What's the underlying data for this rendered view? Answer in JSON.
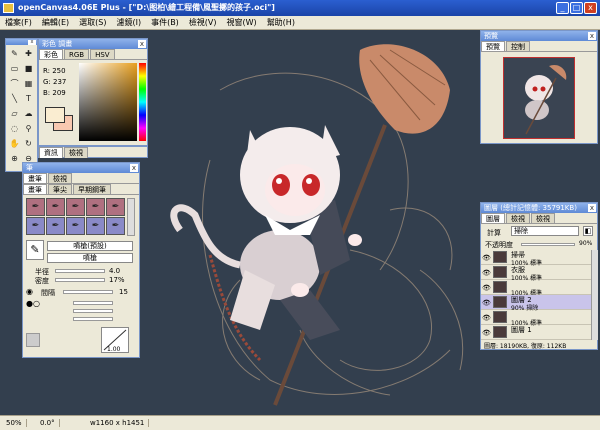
{
  "window": {
    "title": "openCanvas4.06E Plus - [\"D:\\图柏\\繪工程備\\風聖擲的孩子.oci\"]",
    "min": "_",
    "max": "□",
    "close": "x"
  },
  "menu": [
    "檔案(F)",
    "編輯(E)",
    "選取(S)",
    "濾鏡(I)",
    "事件(B)",
    "檢視(V)",
    "視窗(W)",
    "幫助(H)"
  ],
  "color_panel": {
    "title": "彩色 調畫",
    "tabs": [
      "彩色",
      "RGB",
      "HSV"
    ],
    "r": "R: 250",
    "g": "G: 237",
    "b": "B: 209",
    "fg": "#faedd1",
    "bg": "#f8c8b0"
  },
  "tool_icons": [
    "pen-icon",
    "move-icon",
    "rect-select-icon",
    "fill-icon",
    "lasso-icon",
    "gradient-icon",
    "line-icon",
    "text-icon",
    "eraser-icon",
    "smudge-icon",
    "blur-icon",
    "eyedropper-icon",
    "hand-icon",
    "rotate-icon",
    "zoom-in-icon",
    "zoom-out-icon"
  ],
  "tool_glyphs": [
    "✎",
    "✚",
    "▭",
    "■",
    "⌒",
    "▦",
    "╲",
    "T",
    "▱",
    "☁",
    "◌",
    "⚲",
    "✋",
    "↻",
    "⊕",
    "⊖"
  ],
  "brush_panel": {
    "title": "筆",
    "tabs": [
      "畫筆",
      "檢視"
    ],
    "subtabs": [
      "畫筆",
      "筆尖",
      "早期鋼筆"
    ],
    "preset_btn": "噴槍(預設)",
    "name_btn": "噴槍",
    "radius_label": "半徑",
    "radius_val": "4.0",
    "density_label": "密度",
    "density_val": "17%",
    "spacing_label": "間隔",
    "spacing_val": "15",
    "pressure_val": "1.00",
    "under_tabs": [
      "資訊",
      "檢視"
    ]
  },
  "preview_panel": {
    "title": "預覽",
    "tabs": [
      "預覽",
      "控制"
    ]
  },
  "layer_panel": {
    "title": "圖層 (總計記憶體: 35791KB)",
    "tabs": [
      "圖層",
      "檢視",
      "檢視"
    ],
    "blend_label": "計算",
    "blend_val": "掃除",
    "opacity_label": "不透明度",
    "opacity_val": "90%",
    "layers": [
      {
        "name": "掃帚",
        "mode": "100%  標準"
      },
      {
        "name": "衣服",
        "mode": "100%  標準"
      },
      {
        "name": "",
        "mode": "100%  標準"
      },
      {
        "name": "圖層 2",
        "mode": "90%  掃除"
      },
      {
        "name": "",
        "mode": "100%  標準"
      },
      {
        "name": "圖層 1",
        "mode": ""
      }
    ],
    "footer": "圖層: 18190KB, 復原: 112KB"
  },
  "status": {
    "zoom": "50%",
    "angle": "0.0°",
    "size": "w1160 x h1451"
  }
}
